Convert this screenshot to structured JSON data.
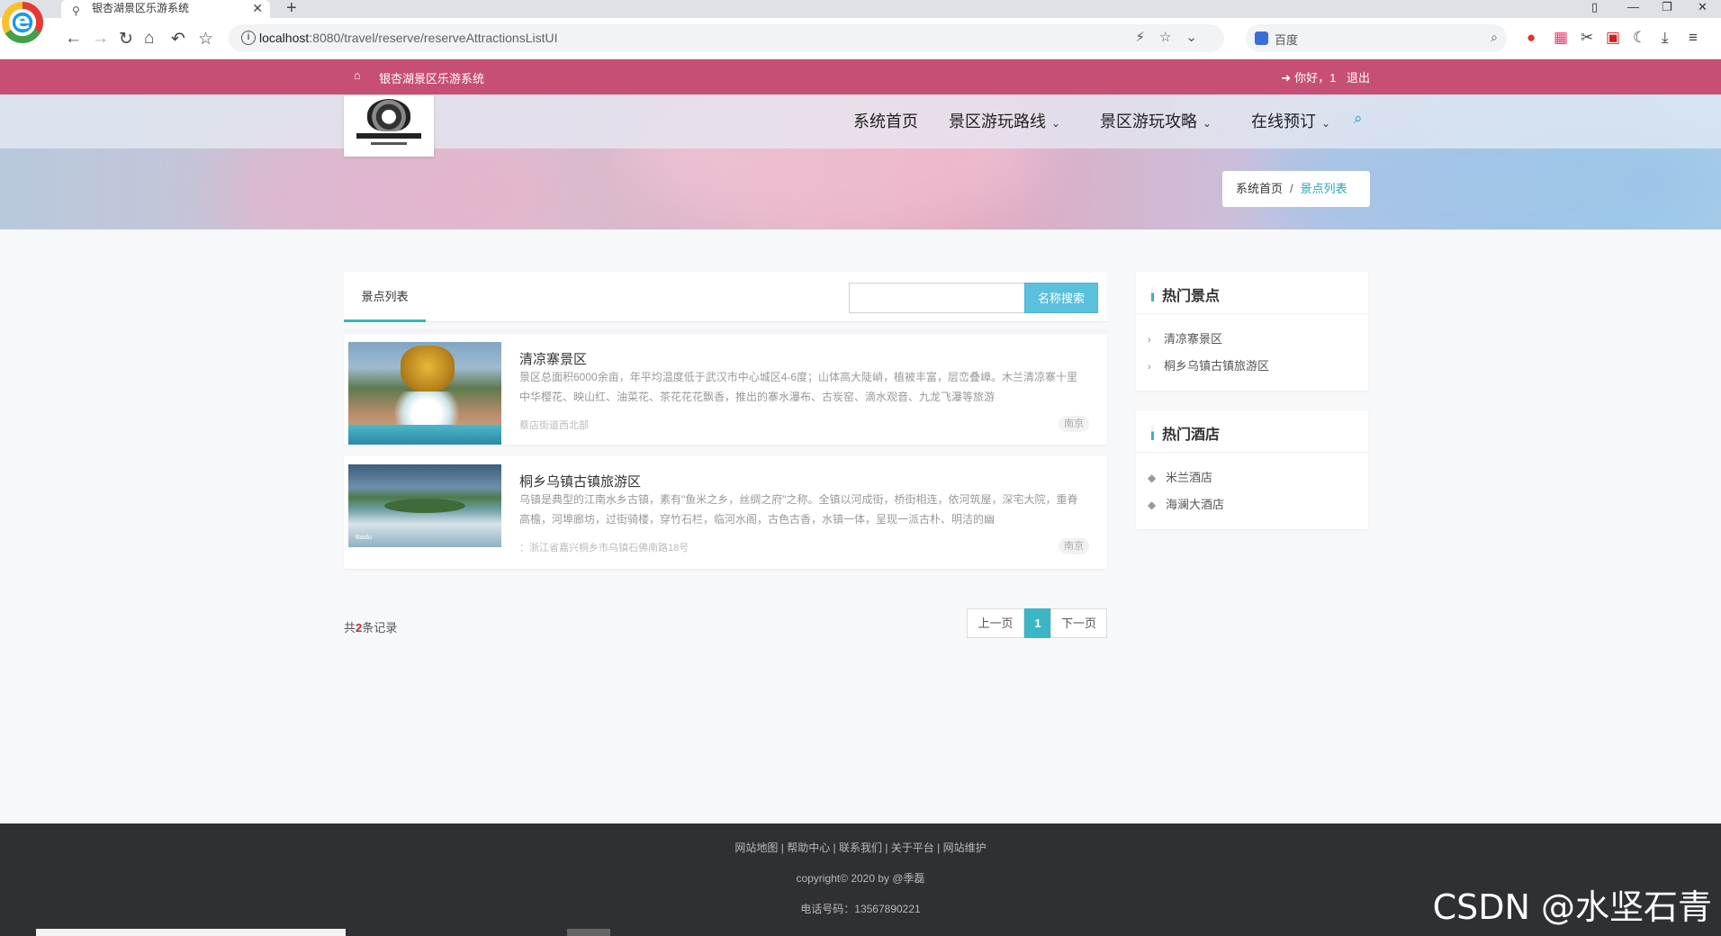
{
  "browser": {
    "tab_title": "银杏湖景区乐游系统",
    "url_host": "localhost",
    "url_path": ":8080/travel/reserve/reserveAttractionsListUI",
    "search_engine": "百度"
  },
  "topbar": {
    "site_name": "银杏湖景区乐游系统",
    "greeting": "你好，1",
    "logout": "退出"
  },
  "nav": {
    "items": [
      "系统首页",
      "景区游玩路线",
      "景区游玩攻略",
      "在线预订"
    ]
  },
  "breadcrumb": {
    "home": "系统首页",
    "sep": "/",
    "current": "景点列表"
  },
  "list": {
    "tab_label": "景点列表",
    "search_button": "名称搜索",
    "search_value": "",
    "items": [
      {
        "name": "清凉寨景区",
        "desc": "景区总面积6000余亩，年平均温度低于武汉市中心城区4-6度；山体高大陡峭，植被丰富，层峦叠嶂。木兰清凉寨十里中华樱花、映山红、油菜花、茶花花花飘香，推出的寨水瀑布、古炭窑、滴水观音、九龙飞瀑等旅游",
        "address": "蔡店街道西北部",
        "city": "南京"
      },
      {
        "name": "桐乡乌镇古镇旅游区",
        "desc": "乌镇是典型的江南水乡古镇，素有\"鱼米之乡，丝绸之府\"之称。全镇以河成街，桥街相连，依河筑屋，深宅大院，重脊高檐，河埠廊坊，过街骑楼，穿竹石栏，临河水阁，古色古香，水镇一体，呈现一派古朴、明洁的幽",
        "address": "：浙江省嘉兴桐乡市乌镇石佛南路18号",
        "city": "南京"
      }
    ],
    "record_prefix": "共",
    "record_count": "2",
    "record_suffix": "条记录",
    "pager": {
      "prev": "上一页",
      "page": "1",
      "next": "下一页"
    }
  },
  "sidebar": {
    "hot_spots_title": "热门景点",
    "hot_spots": [
      "清凉寨景区",
      "桐乡乌镇古镇旅游区"
    ],
    "hot_hotels_title": "热门酒店",
    "hot_hotels": [
      "米兰酒店",
      "海澜大酒店"
    ]
  },
  "footer": {
    "links": "网站地图 | 帮助中心 | 联系我们 | 关于平台 | 网站维护",
    "copyright": "copyright© 2020 by @季磊",
    "phone": "电话号码：13567890221"
  },
  "watermark": "CSDN @水坚石青",
  "colors": {
    "topbar": "#c74f73",
    "accent": "#3cb5ad",
    "search_button": "#5bc0de",
    "footer": "#2f3033"
  }
}
